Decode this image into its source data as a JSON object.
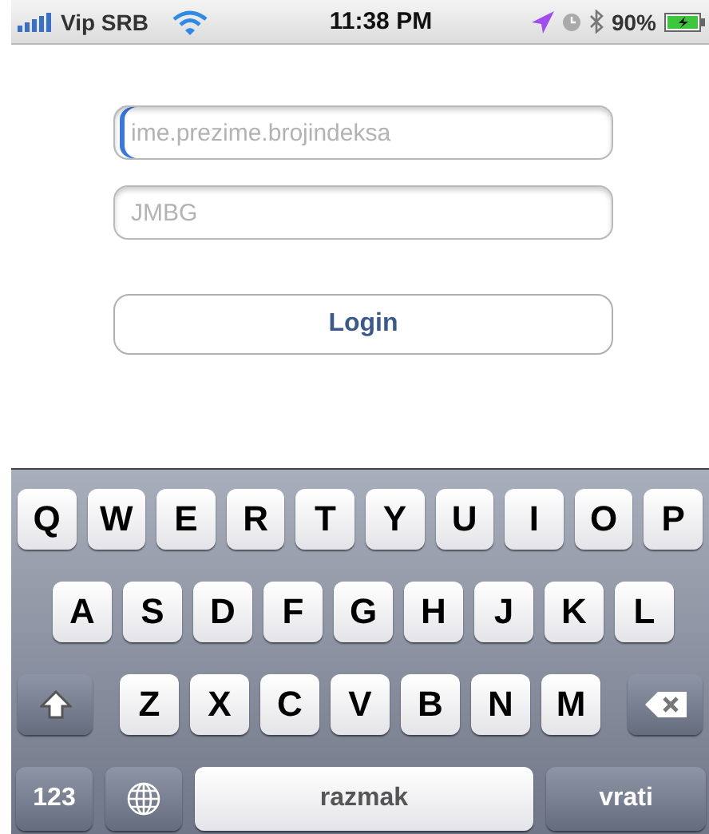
{
  "status_bar": {
    "carrier": "Vip SRB",
    "time": "11:38 PM",
    "battery": "90%"
  },
  "fields": [
    {
      "placeholder": "ime.prezime.brojindeksa",
      "focused": true
    },
    {
      "placeholder": "JMBG",
      "focused": false
    }
  ],
  "login_button": {
    "label": "Login"
  },
  "keyboard": {
    "rows": [
      [
        "Q",
        "W",
        "E",
        "R",
        "T",
        "Y",
        "U",
        "I",
        "O",
        "P"
      ],
      [
        "A",
        "S",
        "D",
        "F",
        "G",
        "H",
        "J",
        "K",
        "L"
      ],
      [
        "Z",
        "X",
        "C",
        "V",
        "B",
        "N",
        "M"
      ]
    ],
    "numbers_key": "123",
    "space_key": "razmak",
    "return_key": "vrati"
  }
}
